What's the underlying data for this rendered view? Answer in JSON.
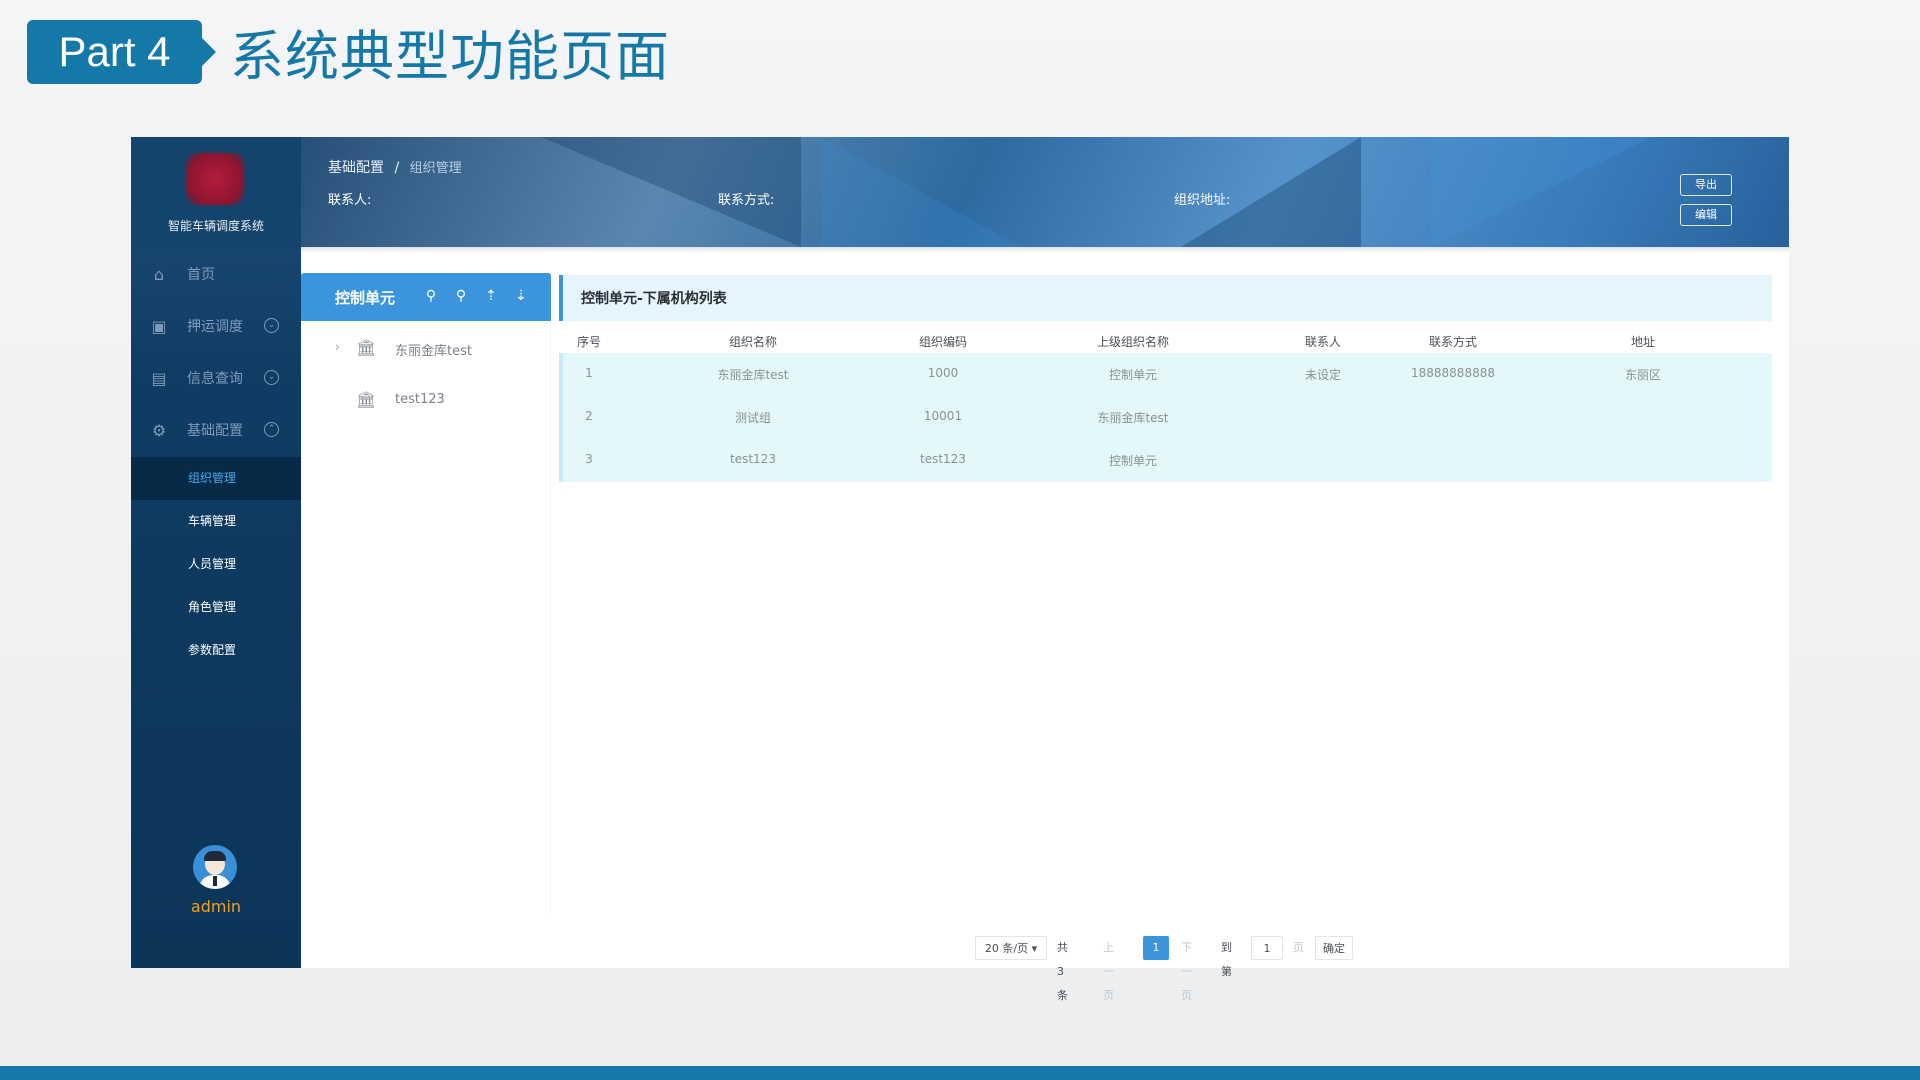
{
  "slide": {
    "part_label": "Part 4",
    "title": "系统典型功能页面"
  },
  "app": {
    "system_name": "智能车辆调度系统",
    "nav": [
      {
        "label": "首页",
        "icon": "home-icon"
      },
      {
        "label": "押运调度",
        "icon": "truck-icon"
      },
      {
        "label": "信息查询",
        "icon": "search-doc-icon"
      },
      {
        "label": "基础配置",
        "icon": "gear-icon"
      }
    ],
    "subnav": [
      "组织管理",
      "车辆管理",
      "人员管理",
      "角色管理",
      "参数配置"
    ],
    "subnav_active_index": 0,
    "user": "admin",
    "breadcrumb": {
      "parent": "基础配置",
      "separator": "/",
      "current": "组织管理"
    },
    "info": {
      "contact_label": "联系人:",
      "phone_label": "联系方式:",
      "address_label": "组织地址:"
    },
    "buttons": {
      "export": "导出",
      "edit": "编辑"
    },
    "tree": {
      "title": "控制单元",
      "tools": [
        "add-node-icon",
        "remove-node-icon",
        "sort-asc-icon",
        "sort-desc-icon"
      ],
      "nodes": [
        {
          "label": "东丽金库test",
          "expandable": true
        },
        {
          "label": "test123",
          "expandable": false
        }
      ]
    },
    "table": {
      "title": "控制单元-下属机构列表",
      "columns": [
        "序号",
        "组织名称",
        "组织编码",
        "上级组织名称",
        "联系人",
        "联系方式",
        "地址"
      ],
      "rows": [
        [
          "1",
          "东丽金库test",
          "1000",
          "控制单元",
          "未设定",
          "18888888888",
          "东丽区"
        ],
        [
          "2",
          "测试组",
          "10001",
          "东丽金库test",
          "",
          "",
          ""
        ],
        [
          "3",
          "test123",
          "test123",
          "控制单元",
          "",
          "",
          ""
        ]
      ]
    },
    "pager": {
      "page_size": "20 条/页",
      "total": "共 3 条",
      "prev": "上一页",
      "current_page": "1",
      "next": "下一页",
      "goto_label": "到第",
      "goto_value": "1",
      "page_unit": "页",
      "confirm": "确定"
    },
    "colors": {
      "brand_blue": "#1478a8",
      "sidebar_dark": "#0f3c63",
      "accent": "#3c95dc",
      "username": "#f0a020"
    }
  }
}
